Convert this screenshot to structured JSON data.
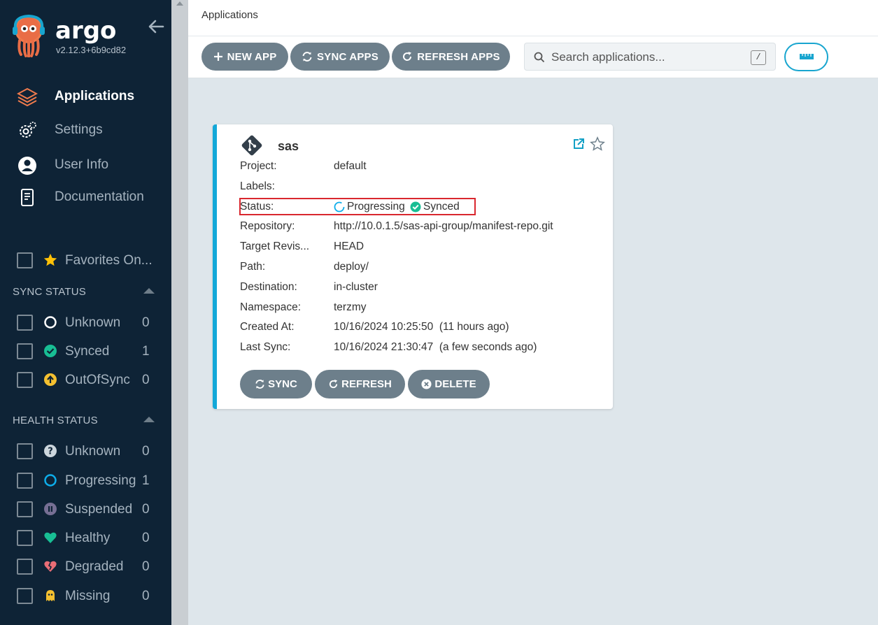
{
  "sidebar": {
    "brand": "argo",
    "version": "v2.12.3+6b9cd82",
    "nav": [
      {
        "label": "Applications",
        "icon": "stack-icon",
        "active": true
      },
      {
        "label": "Settings",
        "icon": "gear-icon"
      },
      {
        "label": "User Info",
        "icon": "user-icon"
      },
      {
        "label": "Documentation",
        "icon": "book-icon"
      }
    ],
    "favorites_label": "Favorites On...",
    "sync_status": {
      "title": "SYNC STATUS",
      "items": [
        {
          "label": "Unknown",
          "count": "0"
        },
        {
          "label": "Synced",
          "count": "1"
        },
        {
          "label": "OutOfSync",
          "count": "0"
        }
      ]
    },
    "health_status": {
      "title": "HEALTH STATUS",
      "items": [
        {
          "label": "Unknown",
          "count": "0"
        },
        {
          "label": "Progressing",
          "count": "1"
        },
        {
          "label": "Suspended",
          "count": "0"
        },
        {
          "label": "Healthy",
          "count": "0"
        },
        {
          "label": "Degraded",
          "count": "0"
        },
        {
          "label": "Missing",
          "count": "0"
        }
      ]
    }
  },
  "header": {
    "title": "Applications"
  },
  "toolbar": {
    "new_app": "NEW APP",
    "sync_apps": "SYNC APPS",
    "refresh_apps": "REFRESH APPS",
    "search_placeholder": "Search applications...",
    "search_shortcut": "/"
  },
  "app": {
    "name": "sas",
    "fields": {
      "project_label": "Project:",
      "project": "default",
      "labels_label": "Labels:",
      "labels": "",
      "status_label": "Status:",
      "health": "Progressing",
      "sync": "Synced",
      "repository_label": "Repository:",
      "repository": "http://10.0.1.5/sas-api-group/manifest-repo.git",
      "target_label": "Target Revis...",
      "target": "HEAD",
      "path_label": "Path:",
      "path": "deploy/",
      "destination_label": "Destination:",
      "destination": "in-cluster",
      "namespace_label": "Namespace:",
      "namespace": "terzmy",
      "created_label": "Created At:",
      "created": "10/16/2024 10:25:50  (11 hours ago)",
      "lastsync_label": "Last Sync:",
      "lastsync": "10/16/2024 21:30:47  (a few seconds ago)"
    },
    "actions": {
      "sync": "SYNC",
      "refresh": "REFRESH",
      "delete": "DELETE"
    }
  },
  "colors": {
    "sidebar_bg": "#0e2336",
    "accent": "#13a8d8",
    "button_bg": "#6d7f8b",
    "synced": "#18be94",
    "highlight_box": "#d9272e"
  }
}
